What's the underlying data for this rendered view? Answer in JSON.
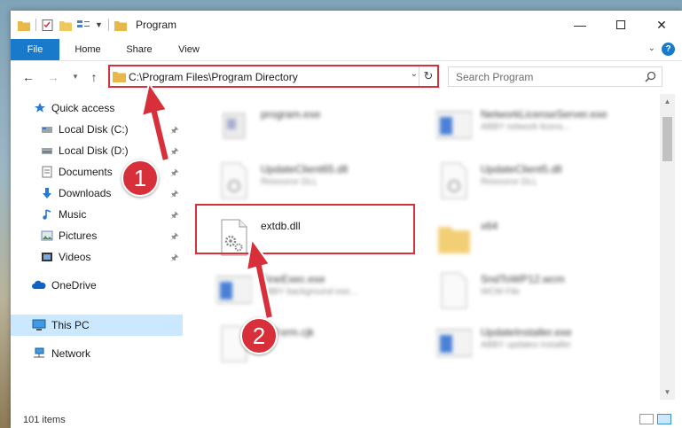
{
  "window": {
    "title": "Program"
  },
  "ribbon": {
    "tabs": [
      "File",
      "Home",
      "Share",
      "View"
    ],
    "help": "?"
  },
  "address": {
    "path": "C:\\Program Files\\Program Directory"
  },
  "search": {
    "placeholder": "Search Program"
  },
  "nav": {
    "items": [
      {
        "label": "Quick access",
        "icon": "star-icon"
      },
      {
        "label": "Local Disk (C:)",
        "icon": "drive-icon"
      },
      {
        "label": "Local Disk (D:)",
        "icon": "drive-icon"
      },
      {
        "label": "Documents",
        "icon": "documents-icon"
      },
      {
        "label": "Downloads",
        "icon": "download-icon"
      },
      {
        "label": "Music",
        "icon": "music-icon"
      },
      {
        "label": "Pictures",
        "icon": "pictures-icon"
      },
      {
        "label": "Videos",
        "icon": "videos-icon"
      },
      {
        "label": "OneDrive",
        "icon": "cloud-icon"
      },
      {
        "label": "This PC",
        "icon": "computer-icon"
      },
      {
        "label": "Network",
        "icon": "network-icon"
      }
    ]
  },
  "files": [
    {
      "name": "program.exe",
      "desc": ""
    },
    {
      "name": "NetworkLicenseServer.exe",
      "desc": "ABBY network licens..."
    },
    {
      "name": "UpdateClient65.dll",
      "desc": "Resource DLL"
    },
    {
      "name": "UpdateClient5.dll",
      "desc": "Resource DLL"
    },
    {
      "name": "extdb.dll",
      "desc": ""
    },
    {
      "name": "x64",
      "desc": ""
    },
    {
      "name": "FineExec.exe",
      "desc": "ABBY background exe..."
    },
    {
      "name": "SndToWP12.wcm",
      "desc": "WCM File"
    },
    {
      "name": "FdForm.cjk",
      "desc": ""
    },
    {
      "name": "UpdateInstaller.exe",
      "desc": "ABBY updates installer"
    }
  ],
  "status": {
    "count": "101 items"
  },
  "annotations": {
    "step1": "1",
    "step2": "2",
    "color": "#d7303a"
  }
}
